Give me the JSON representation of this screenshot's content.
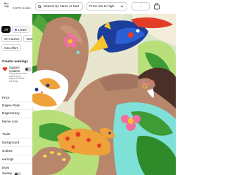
{
  "header": {
    "results_count": "3,979 results",
    "search": {
      "placeholder": "Search by name or trait",
      "value": ""
    },
    "sort": {
      "selected": "Price low to high"
    }
  },
  "sidebar": {
    "status_chips": [
      {
        "label": "All",
        "active": true
      },
      {
        "label": "Listed",
        "active": false
      },
      {
        "label": "On Auction",
        "active": false
      },
      {
        "label": "New",
        "active": false
      },
      {
        "label": "Has offers",
        "active": false
      }
    ],
    "creator_earnings": {
      "title": "Creator earnings",
      "support_label": "Support creators",
      "support_note": "Only partners has opted out to support creator earnings",
      "enabled": false
    },
    "filters": [
      "Price",
      "Degen Rank",
      "Degeneracy",
      "Meme coin"
    ],
    "traits": [
      "Traits",
      "background",
      "clothes",
      "earrings",
      "Eyes"
    ],
    "sweep": {
      "label": "Sweep",
      "enabled": false
    }
  },
  "artwork": {
    "colors": {
      "sky": "#e9e6d0",
      "leaf_dark": "#2f8a2a",
      "leaf_light": "#b8df7a",
      "skin": "#b8866b",
      "spaceship": "#1d3f9c",
      "cat_orange": "#f0a23a",
      "flower_pink": "#f26f9f",
      "turquoise": "#7fe0d8"
    }
  }
}
